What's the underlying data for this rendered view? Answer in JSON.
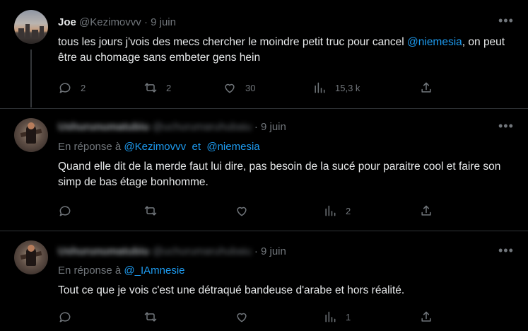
{
  "tweets": [
    {
      "name": "Joe",
      "handle": "@Kezimovvv",
      "sep": "·",
      "time": "9 juin",
      "text_before": "tous les jours j'vois des mecs chercher le moindre petit truc pour cancel ",
      "mention": "@niemesia",
      "text_after": ", on peut être au chomage sans embeter gens hein",
      "replies": "2",
      "retweets": "2",
      "likes": "30",
      "views": "15,3 k"
    },
    {
      "name": "Ushurunumatubiu",
      "handle": "@uchurumaruhubaiu",
      "sep": "·",
      "time": "9 juin",
      "reply_prefix": "En réponse à",
      "reply_to_1": "@Kezimovvv",
      "reply_and": "et",
      "reply_to_2": "@niemesia",
      "text": "Quand elle dit de la merde faut lui dire, pas besoin de la sucé pour paraitre cool et faire son simp de bas étage bonhomme.",
      "views": "2"
    },
    {
      "name": "Ushurunumatubiu",
      "handle": "@uchurumaruhubaiu",
      "sep": "·",
      "time": "9 juin",
      "reply_prefix": "En réponse à",
      "reply_to_1": "@_IAmnesie",
      "text": "Tout ce que je vois c'est une détraqué bandeuse d'arabe et hors réalité.",
      "views": "1"
    }
  ],
  "icons": [
    "reply-icon",
    "retweet-icon",
    "like-icon",
    "views-icon",
    "share-icon",
    "more-icon"
  ],
  "colors": {
    "background": "#000000",
    "link": "#1d9bf0",
    "muted": "#71767b",
    "text": "#e7e9ea",
    "divider": "#2f3336"
  }
}
